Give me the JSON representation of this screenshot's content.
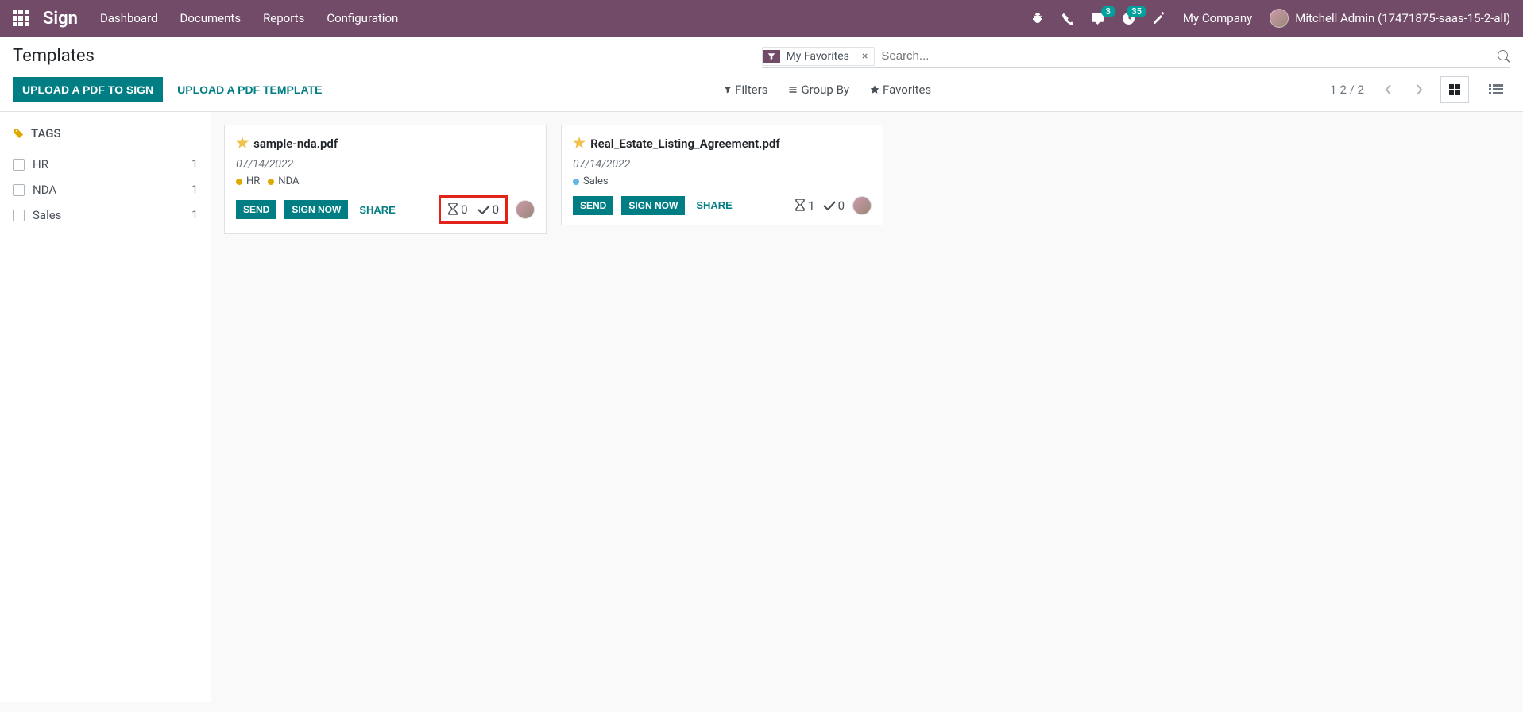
{
  "navbar": {
    "brand": "Sign",
    "links": [
      "Dashboard",
      "Documents",
      "Reports",
      "Configuration"
    ],
    "messaging_badge": "3",
    "activities_badge": "35",
    "company": "My Company",
    "user": "Mitchell Admin (17471875-saas-15-2-all)"
  },
  "control": {
    "title": "Templates",
    "upload_pdf_sign": "UPLOAD A PDF TO SIGN",
    "upload_pdf_template": "UPLOAD A PDF TEMPLATE",
    "search_tag": "My Favorites",
    "search_placeholder": "Search...",
    "filters_label": "Filters",
    "groupby_label": "Group By",
    "favorites_label": "Favorites",
    "pager": "1-2 / 2"
  },
  "sidebar": {
    "header": "TAGS",
    "items": [
      {
        "label": "HR",
        "count": "1"
      },
      {
        "label": "NDA",
        "count": "1"
      },
      {
        "label": "Sales",
        "count": "1"
      }
    ]
  },
  "cards": [
    {
      "title": "sample-nda.pdf",
      "date": "07/14/2022",
      "tags": [
        {
          "label": "HR",
          "color": "#e0a800"
        },
        {
          "label": "NDA",
          "color": "#e0a800"
        }
      ],
      "send": "SEND",
      "sign_now": "SIGN NOW",
      "share": "SHARE",
      "pending": "0",
      "done": "0",
      "highlight": true
    },
    {
      "title": "Real_Estate_Listing_Agreement.pdf",
      "date": "07/14/2022",
      "tags": [
        {
          "label": "Sales",
          "color": "#62b5e5"
        }
      ],
      "send": "SEND",
      "sign_now": "SIGN NOW",
      "share": "SHARE",
      "pending": "1",
      "done": "0",
      "highlight": false
    }
  ]
}
